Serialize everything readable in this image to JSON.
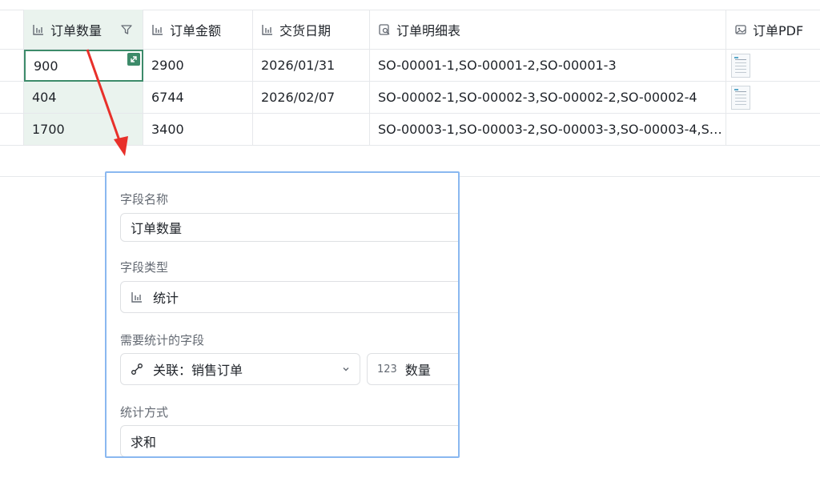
{
  "table": {
    "columns": [
      {
        "label": "订单数量",
        "icon": "stat-icon"
      },
      {
        "label": "订单金额",
        "icon": "stat-icon"
      },
      {
        "label": "交货日期",
        "icon": "stat-icon"
      },
      {
        "label": "订单明细表",
        "icon": "lookup-icon"
      },
      {
        "label": "订单PDF",
        "icon": "image-icon"
      }
    ],
    "rows": [
      {
        "qty": "900",
        "amount": "2900",
        "date": "2026/01/31",
        "details": "SO-00001-1,SO-00001-2,SO-00001-3",
        "pdf": true
      },
      {
        "qty": "404",
        "amount": "6744",
        "date": "2026/02/07",
        "details": "SO-00002-1,SO-00002-3,SO-00002-2,SO-00002-4",
        "pdf": true
      },
      {
        "qty": "1700",
        "amount": "3400",
        "date": "",
        "details": "SO-00003-1,SO-00003-2,SO-00003-3,SO-00003-4,SO...",
        "pdf": false
      }
    ]
  },
  "panel": {
    "field_name_label": "字段名称",
    "field_name_value": "订单数量",
    "field_type_label": "字段类型",
    "field_type_value": "统计",
    "stat_field_label": "需要统计的字段",
    "relation_value": "关联：销售订单",
    "number_tag": "123",
    "number_field_value": "数量",
    "method_label": "统计方式",
    "method_value": "求和"
  },
  "colors": {
    "accent_green": "#3d8b6a",
    "selected_column_bg": "#eaf3ee",
    "panel_border": "#8ab8f0",
    "arrow_red": "#e8302a"
  }
}
